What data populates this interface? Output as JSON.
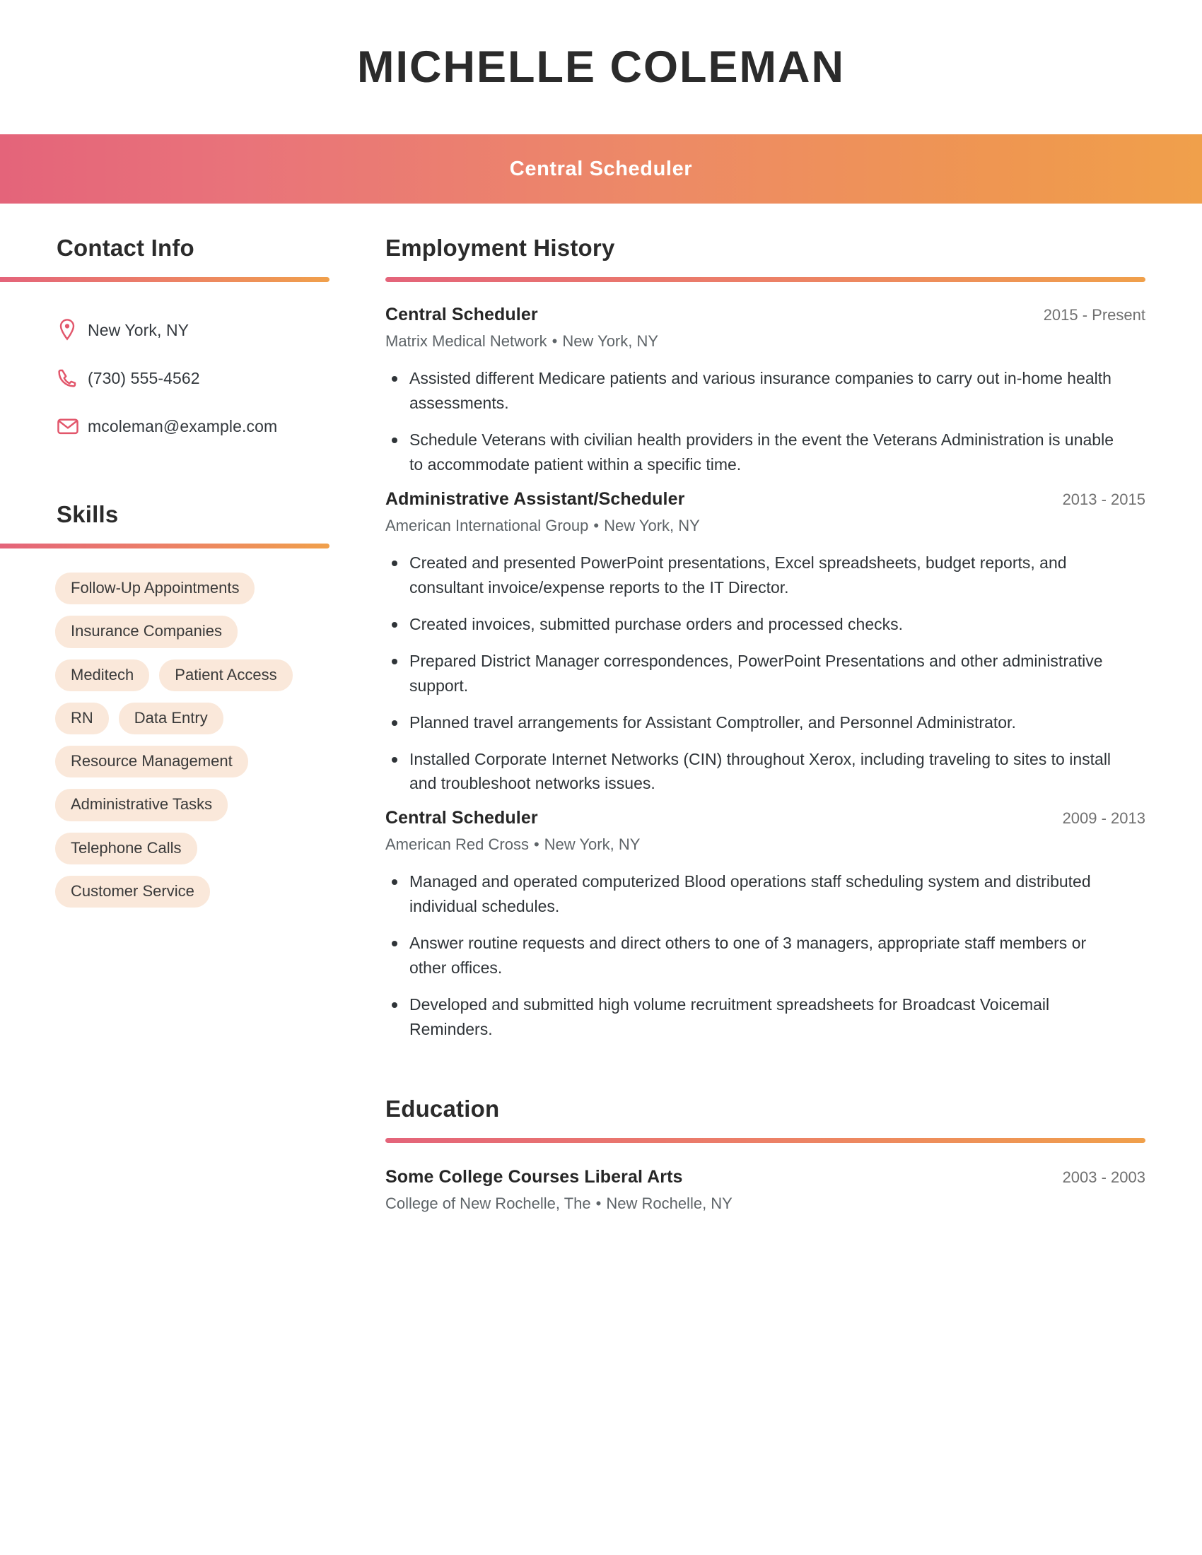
{
  "header": {
    "name": "MICHELLE COLEMAN",
    "job_title": "Central Scheduler",
    "banner_gradient_start": "#e4647a",
    "banner_gradient_end": "#f0a04b"
  },
  "sidebar": {
    "contact": {
      "heading": "Contact Info",
      "items": [
        {
          "icon": "location-pin-icon",
          "value": "New York, NY"
        },
        {
          "icon": "phone-icon",
          "value": "(730) 555-4562"
        },
        {
          "icon": "envelope-icon",
          "value": "mcoleman@example.com"
        }
      ]
    },
    "skills": {
      "heading": "Skills",
      "chip_color": "#fae8da",
      "items": [
        "Follow-Up Appointments",
        "Insurance Companies",
        "Meditech",
        "Patient Access",
        "RN",
        "Data Entry",
        "Resource Management",
        "Administrative Tasks",
        "Telephone Calls",
        "Customer Service"
      ]
    }
  },
  "main": {
    "experience": {
      "heading": "Employment History",
      "entries": [
        {
          "title": "Central Scheduler",
          "dates": "2015 - Present",
          "company": "Matrix Medical Network",
          "location": "New York, NY",
          "bullets": [
            "Assisted different Medicare patients and various insurance companies to carry out in-home health assessments.",
            "Schedule Veterans with civilian health providers in the event the Veterans Administration is unable to accommodate patient within a specific time."
          ]
        },
        {
          "title": "Administrative Assistant/Scheduler",
          "dates": "2013 - 2015",
          "company": "American International Group",
          "location": "New York, NY",
          "bullets": [
            "Created and presented PowerPoint presentations, Excel spreadsheets, budget reports, and consultant invoice/expense reports to the IT Director.",
            "Created invoices, submitted purchase orders and processed checks.",
            "Prepared District Manager correspondences, PowerPoint Presentations and other administrative support.",
            "Planned travel arrangements for Assistant Comptroller, and Personnel Administrator.",
            "Installed Corporate Internet Networks (CIN) throughout Xerox, including traveling to sites to install and troubleshoot networks issues."
          ]
        },
        {
          "title": "Central Scheduler",
          "dates": "2009 - 2013",
          "company": "American Red Cross",
          "location": "New York, NY",
          "bullets": [
            "Managed and operated computerized Blood operations staff scheduling system and distributed individual schedules.",
            "Answer routine requests and direct others to one of 3 managers, appropriate staff members or other offices.",
            "Developed and submitted high volume recruitment spreadsheets for Broadcast Voicemail Reminders."
          ]
        }
      ]
    },
    "education": {
      "heading": "Education",
      "entries": [
        {
          "title": "Some College Courses Liberal Arts",
          "dates": "2003 - 2003",
          "school": "College of New Rochelle, The",
          "location": "New Rochelle, NY"
        }
      ]
    }
  },
  "separator": {
    "bullet": "•"
  }
}
